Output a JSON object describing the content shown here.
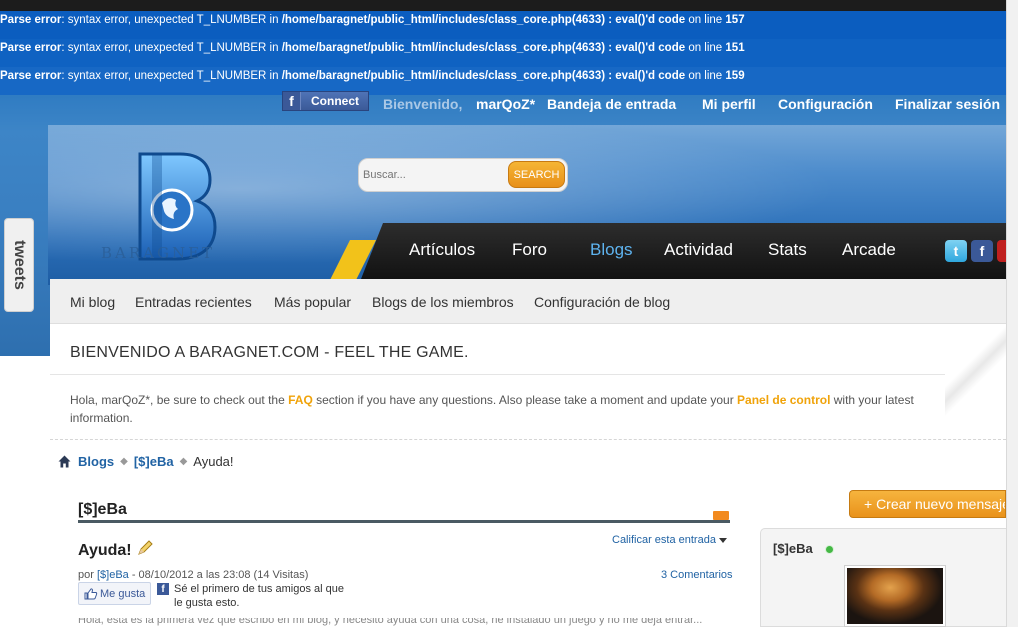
{
  "errors": [
    {
      "prefix": "Parse error",
      "message": ": syntax error, unexpected T_LNUMBER in ",
      "path": "/home/baragnet/public_html/includes/class_core.php(4633) : eval()'d code",
      "suffix": " on line ",
      "line": "157"
    },
    {
      "prefix": "Parse error",
      "message": ": syntax error, unexpected T_LNUMBER in ",
      "path": "/home/baragnet/public_html/includes/class_core.php(4633) : eval()'d code",
      "suffix": " on line ",
      "line": "151"
    },
    {
      "prefix": "Parse error",
      "message": ": syntax error, unexpected T_LNUMBER in ",
      "path": "/home/baragnet/public_html/includes/class_core.php(4633) : eval()'d code",
      "suffix": " on line ",
      "line": "159"
    }
  ],
  "userbar": {
    "fb_connect": "Connect",
    "welcome": "Bienvenido,",
    "username": "marQoZ*",
    "inbox": "Bandeja de entrada",
    "profile": "Mi perfil",
    "settings": "Configuración",
    "logout": "Finalizar sesión"
  },
  "header": {
    "logo_text": "BARAGNET",
    "search_placeholder": "Buscar...",
    "search_button": "SEARCH"
  },
  "nav": {
    "items": [
      "Artículos",
      "Foro",
      "Blogs",
      "Actividad",
      "Stats",
      "Arcade"
    ],
    "active": "Blogs",
    "tweets_tab": "tweets"
  },
  "subnav": {
    "items": [
      "Mi blog",
      "Entradas recientes",
      "Más popular",
      "Blogs de los miembros",
      "Configuración de blog"
    ]
  },
  "welcome": {
    "title": "BIENVENIDO A BARAGNET.COM - FEEL THE GAME.",
    "text_1": "Hola, marQoZ*, be sure to check out the ",
    "faq": "FAQ",
    "text_2": " section if you have any questions. Also please take a moment and update your ",
    "panel": "Panel de control",
    "text_3": " with your latest information."
  },
  "breadcrumb": {
    "items": [
      "Blogs",
      "[$]eBa",
      "Ayuda!"
    ]
  },
  "blog": {
    "title": "[$]eBa",
    "create_button": "+ Crear nuevo mensaje",
    "entry": {
      "title": "Ayuda!",
      "rate": "Calificar esta entrada",
      "meta_by": "por ",
      "meta_author": "[$]eBa",
      "meta_rest": " - 08/10/2012 a las 23:08 (14 Visitas)",
      "comments": "3 Comentarios",
      "like_button": "Me gusta",
      "like_text": "Sé el primero de tus amigos al que le gusta esto.",
      "body_preview": "Hola, esta es la primera vez que escribo en mi blog, y necesito ayuda con una cosa, he instalado un juego y no me deja entrar..."
    }
  },
  "sidebar": {
    "username": "[$]eBa"
  },
  "colors": {
    "accent_orange": "#e9921b",
    "link_blue": "#2163a4",
    "nav_active": "#5eb3ef",
    "page_blue": "#2a78c0"
  }
}
